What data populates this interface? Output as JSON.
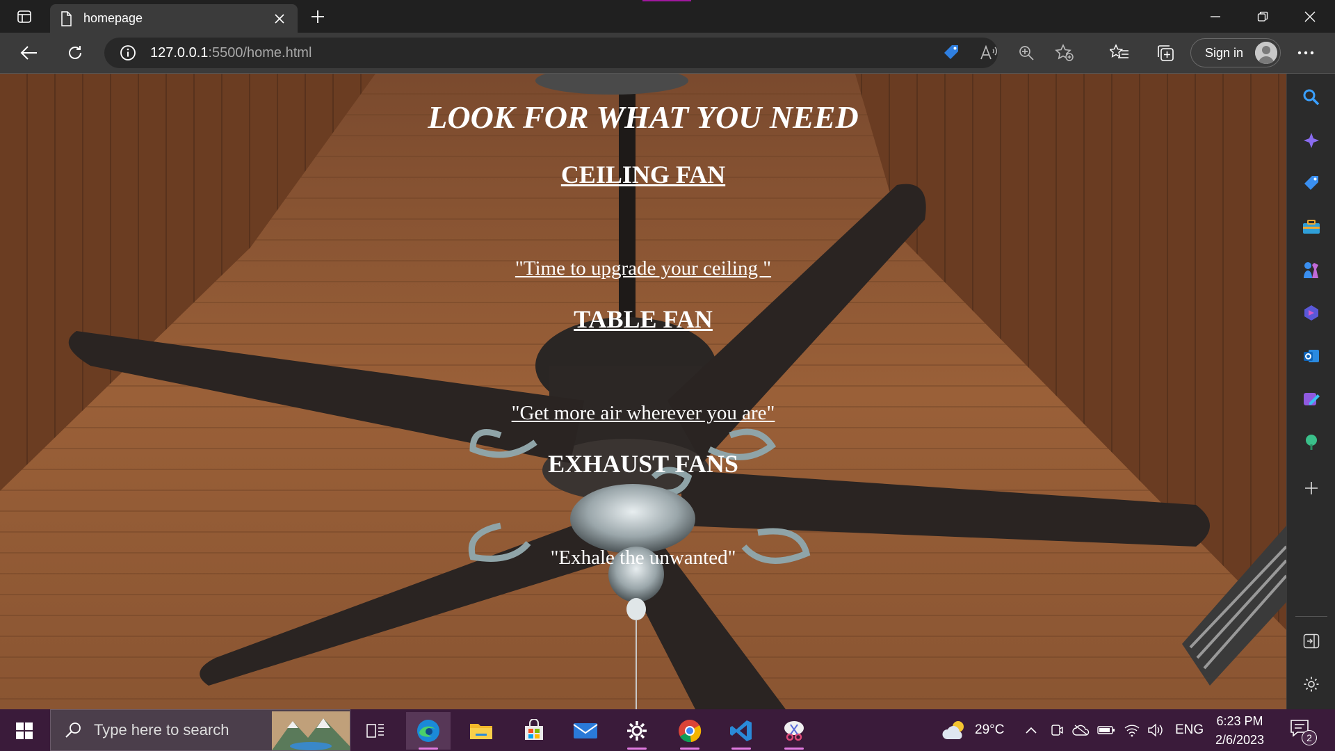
{
  "browser": {
    "tab": {
      "title": "homepage"
    },
    "address": {
      "host": "127.0.0.1",
      "path": ":5500/home.html"
    },
    "signin_label": "Sign in"
  },
  "page": {
    "heading": "LOOK FOR WHAT YOU NEED",
    "sections": [
      {
        "title": "CEILING FAN",
        "tagline": "\"Time to upgrade your ceiling \""
      },
      {
        "title": "TABLE FAN",
        "tagline": "\"Get more air wherever you are\""
      },
      {
        "title": "EXHAUST FANS",
        "tagline": "\"Exhale the unwanted\""
      }
    ]
  },
  "taskbar": {
    "search_placeholder": "Type here to search",
    "weather": "29°C",
    "language": "ENG",
    "time": "6:23 PM",
    "date": "2/6/2023",
    "notification_count": "2"
  },
  "colors": {
    "accent": "#a0179e",
    "taskbar": "#3a1b3a",
    "toolbar": "#3b3b3b"
  }
}
